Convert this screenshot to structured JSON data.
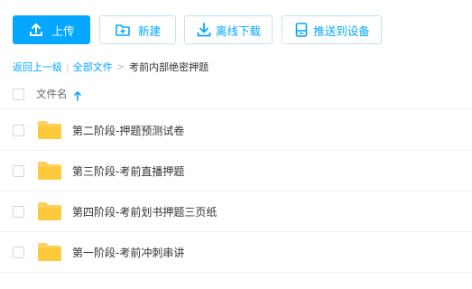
{
  "colors": {
    "accent": "#06a7ff",
    "folder": "#ffd05b"
  },
  "toolbar": {
    "upload": {
      "label": "上传",
      "icon": "upload-icon"
    },
    "new": {
      "label": "新建",
      "icon": "new-folder-icon"
    },
    "offline": {
      "label": "离线下载",
      "icon": "download-icon"
    },
    "push": {
      "label": "推送到设备",
      "icon": "device-icon"
    }
  },
  "breadcrumb": {
    "back": "返回上一级",
    "sep": "|",
    "all_files": "全部文件",
    "arrow": ">",
    "current": "考前内部绝密押题"
  },
  "list": {
    "column_name": "文件名",
    "sort_icon": "arrow-up-icon",
    "items": [
      {
        "name": "第二阶段-押题预测试卷",
        "type": "folder"
      },
      {
        "name": "第三阶段-考前直播押题",
        "type": "folder"
      },
      {
        "name": "第四阶段-考前划书押题三页纸",
        "type": "folder"
      },
      {
        "name": "第一阶段-考前冲刺串讲",
        "type": "folder"
      }
    ]
  }
}
